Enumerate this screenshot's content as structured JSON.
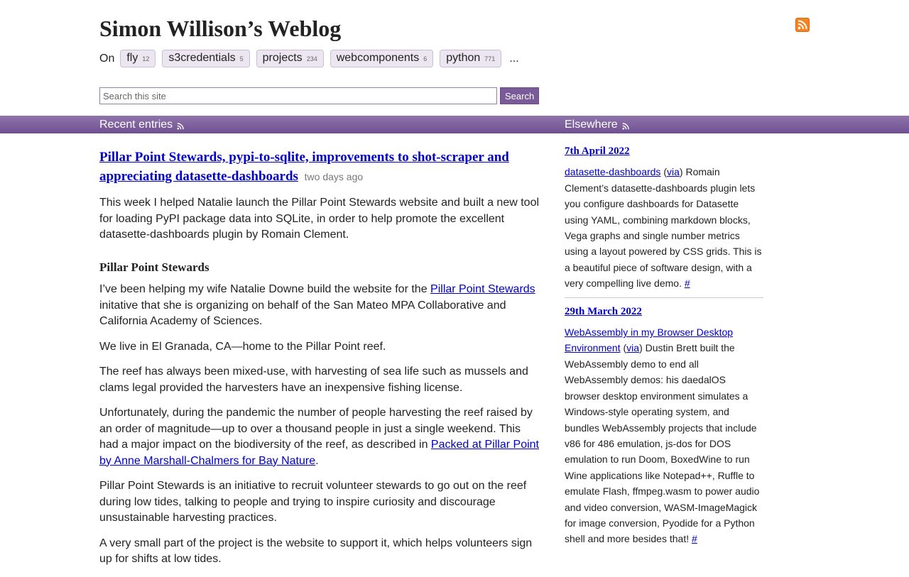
{
  "site": {
    "title": "Simon Willison’s Weblog"
  },
  "tagline": {
    "on_label": "On",
    "tags": [
      {
        "name": "fly",
        "count": "12"
      },
      {
        "name": "s3credentials",
        "count": "5"
      },
      {
        "name": "projects",
        "count": "234"
      },
      {
        "name": "webcomponents",
        "count": "6"
      },
      {
        "name": "python",
        "count": "771"
      }
    ],
    "more": "..."
  },
  "search": {
    "placeholder": "Search this site",
    "button_label": "Search"
  },
  "bar": {
    "recent_label": "Recent entries",
    "elsewhere_label": "Elsewhere"
  },
  "entry": {
    "title": "Pillar Point Stewards, pypi-to-sqlite, improvements to shot-scraper and appreciating datasette-dashboards",
    "date": "two days ago",
    "intro": "This week I helped Natalie launch the Pillar Point Stewards website and built a new tool for loading PyPI package data into SQLite, in order to help promote the excellent datasette-dashboards plugin by Romain Clement.",
    "section_heading": "Pillar Point Stewards",
    "p1_before": "I’ve been helping my wife Natalie Downe build the website for the ",
    "p1_link": "Pillar Point Stewards",
    "p1_after": " initative that she is organizing on behalf of the San Mateo MPA Collaborative and California Academy of Sciences.",
    "p2": "We live in El Granada, CA—home to the Pillar Point reef.",
    "p3": "The reef has always been mixed-use, with harvesting of sea life such as mussels and clams legal provided the harvesters have an inexpensive fishing license.",
    "p4_before": "Unfortunately, during the pandemic the number of people harvesting the reef raised by an order of magnitude—up to over a thousand people in just a single weekend. This had a major impact on the biodiversity of the reef, as described in ",
    "p4_link": "Packed at Pillar Point by Anne Marshall-Chalmers for Bay Nature",
    "p4_after": ".",
    "p5": "Pillar Point Stewards is an initiative to recruit volunteer stewards to go out on the reef during low tides, talking to people and trying to inspire curiosity and discourage unsustainable harvesting practices.",
    "p6": "A very small part of the project is the website to support it, which helps volunteers sign up for shifts at low tides."
  },
  "elsewhere": [
    {
      "date": "7th April 2022",
      "link": "datasette-dashboards",
      "open_paren": " (",
      "via": "via",
      "text": ") Romain Clement’s datasette-dashboards plugin lets you configure dashboards for Datasette using YAML, combining markdown blocks, Vega graphs and single number metrics using a layout powered by CSS grids. This is a beautiful piece of software design, with a very compelling live demo. ",
      "permalink": "#"
    },
    {
      "date": "29th March 2022",
      "link": "WebAssembly in my Browser Desktop Environment",
      "open_paren": " (",
      "via": "via",
      "text": ") Dustin Brett built the WebAssembly demo to end all WebAssembly demos: his daedalOS browser desktop environment simulates a Windows-style operating system, and bundles WebAssembly projects that include v86 for 486 emulation, js-dos for DOS emulation to run Doom, BoxedWine to run Wine applications like Notepad++, Ruffle to emulate Flash, ffmpeg.wasm to power audio and video conversion, WASM-ImageMagick for image conversion, Pyodide for a Python shell and more besides that! ",
      "permalink": "#"
    }
  ],
  "colors": {
    "bar": "#7a5a98",
    "tag_bg": "#ece6f1",
    "link": "#0000cc",
    "rss": "#f78422"
  },
  "icons": {
    "rss": "rss-feed-icon"
  }
}
